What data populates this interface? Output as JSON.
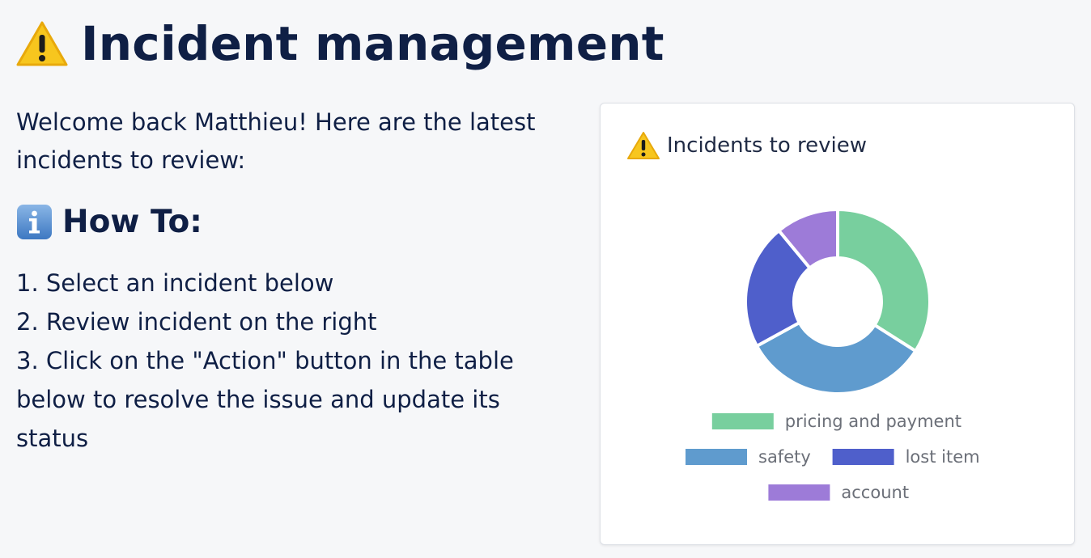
{
  "header": {
    "title": "Incident management",
    "icon": "warning-icon"
  },
  "intro": {
    "text": "Welcome back Matthieu! Here are the latest incidents to review:"
  },
  "howto": {
    "heading": "How To:",
    "icon": "info-icon",
    "steps": [
      "1. Select an incident below",
      "2. Review incident on the right",
      "3. Click on the \"Action\" button in the table below to resolve the issue and update its status"
    ]
  },
  "card": {
    "title": "Incidents to review",
    "icon": "warning-icon"
  },
  "chart_data": {
    "type": "pie",
    "donut": true,
    "title": "Incidents to review",
    "categories": [
      "pricing and payment",
      "safety",
      "lost item",
      "account"
    ],
    "values": [
      34,
      33,
      22,
      11
    ],
    "colors": [
      "#78cf9e",
      "#5f9bce",
      "#4f5fcb",
      "#9d7bd8"
    ],
    "legend_position": "bottom"
  }
}
